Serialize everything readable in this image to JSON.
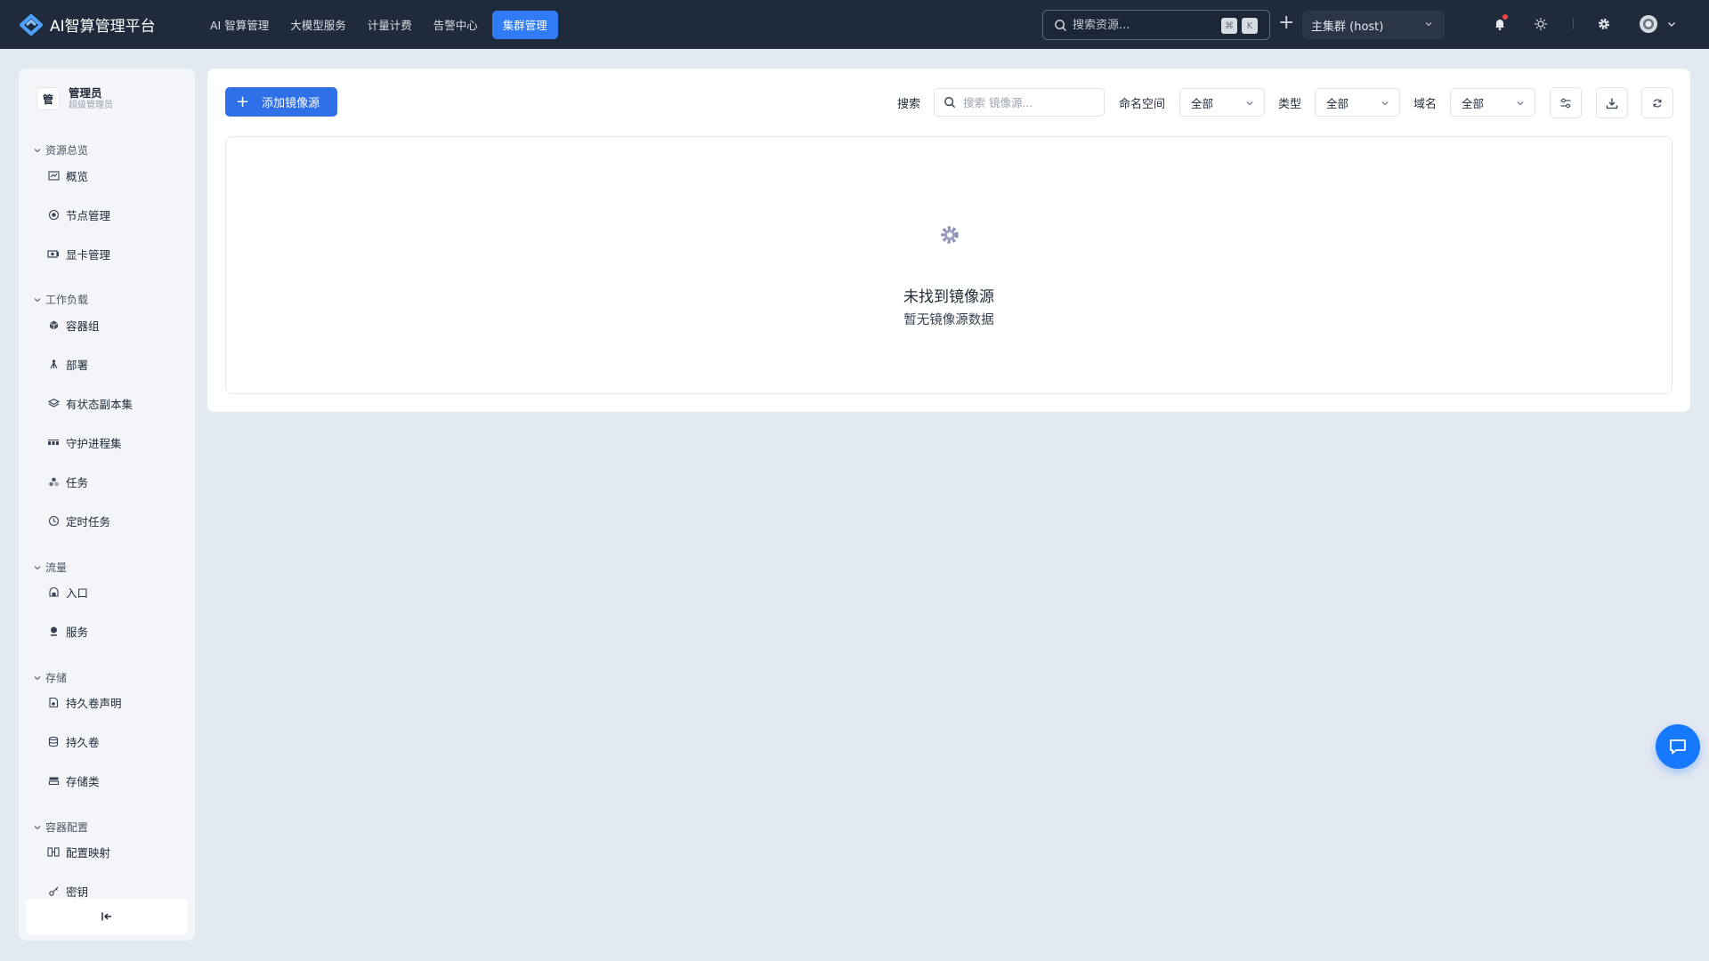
{
  "app": {
    "title": "AI智算管理平台"
  },
  "nav": [
    {
      "label": "AI 智算管理"
    },
    {
      "label": "大模型服务"
    },
    {
      "label": "计量计费"
    },
    {
      "label": "告警中心"
    },
    {
      "label": "集群管理",
      "active": true
    }
  ],
  "global_search": {
    "placeholder": "搜索资源...",
    "shortcut": [
      "⌘",
      "K"
    ]
  },
  "cluster": {
    "selected": "主集群 (host)"
  },
  "header_icons": [
    "plus-icon",
    "bell-icon",
    "sun-icon",
    "gear-icon",
    "avatar-icon",
    "chevron-down-icon"
  ],
  "notifications": {
    "has_unread": true
  },
  "user": {
    "avatar_char": "管",
    "name": "管理员",
    "role": "超级管理员"
  },
  "sidebar": {
    "groups": [
      {
        "title": "资源总览",
        "items": [
          {
            "label": "概览",
            "icon": "chart-icon"
          },
          {
            "label": "节点管理",
            "icon": "node-icon"
          },
          {
            "label": "显卡管理",
            "icon": "gpu-icon"
          }
        ]
      },
      {
        "title": "工作负载",
        "items": [
          {
            "label": "容器组",
            "icon": "cube-icon"
          },
          {
            "label": "部署",
            "icon": "deploy-icon"
          },
          {
            "label": "有状态副本集",
            "icon": "layers-icon"
          },
          {
            "label": "守护进程集",
            "icon": "daemon-icon"
          },
          {
            "label": "任务",
            "icon": "job-icon"
          },
          {
            "label": "定时任务",
            "icon": "clock-icon"
          }
        ]
      },
      {
        "title": "流量",
        "items": [
          {
            "label": "入口",
            "icon": "ingress-icon"
          },
          {
            "label": "服务",
            "icon": "service-icon"
          }
        ]
      },
      {
        "title": "存储",
        "items": [
          {
            "label": "持久卷声明",
            "icon": "pvc-icon"
          },
          {
            "label": "持久卷",
            "icon": "database-icon"
          },
          {
            "label": "存储类",
            "icon": "storage-class-icon"
          }
        ]
      },
      {
        "title": "容器配置",
        "items": [
          {
            "label": "配置映射",
            "icon": "configmap-icon"
          },
          {
            "label": "密钥",
            "icon": "key-icon"
          }
        ]
      }
    ],
    "collapse_icon": "collapse-left-icon"
  },
  "toolbar": {
    "add_label": "添加镜像源",
    "search_label": "搜索",
    "search_placeholder": "搜索 镜像源...",
    "namespace_label": "命名空间",
    "namespace_value": "全部",
    "type_label": "类型",
    "type_value": "全部",
    "domain_label": "域名",
    "domain_value": "全部",
    "tool_icons": [
      "filter-settings-icon",
      "download-icon",
      "refresh-icon"
    ]
  },
  "empty_state": {
    "icon": "gear-icon",
    "title": "未找到镜像源",
    "subtitle": "暂无镜像源数据"
  },
  "colors": {
    "topbar": "#1f2b3d",
    "accent": "#2f6fe8",
    "page_bg": "#e3e9f1",
    "fab": "#1677ff",
    "badge": "#ef4444"
  }
}
